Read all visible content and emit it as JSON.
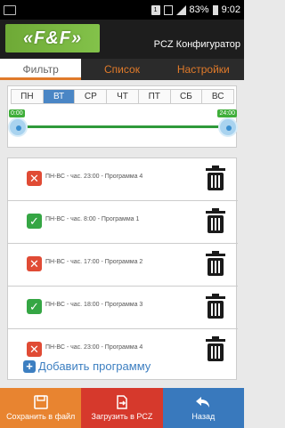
{
  "status_bar": {
    "battery": "83%",
    "time": "9:02",
    "sim_label": "1"
  },
  "app": {
    "logo_text": "«F&F»",
    "title": "PCZ Конфигуратор"
  },
  "tabs": [
    {
      "label": "Фильтр",
      "active": true
    },
    {
      "label": "Список",
      "active": false
    },
    {
      "label": "Настройки",
      "active": false
    }
  ],
  "days": [
    {
      "label": "ПН",
      "active": false
    },
    {
      "label": "ВТ",
      "active": true
    },
    {
      "label": "СР",
      "active": false
    },
    {
      "label": "ЧТ",
      "active": false
    },
    {
      "label": "ПТ",
      "active": false
    },
    {
      "label": "СБ",
      "active": false
    },
    {
      "label": "ВС",
      "active": false
    }
  ],
  "time_range": {
    "start": "0:00",
    "end": "24:00"
  },
  "programs": [
    {
      "text": "ПН-ВС - час. 23:00 - Программа 4",
      "enabled": false
    },
    {
      "text": "ПН-ВС - час. 8:00 - Программа 1",
      "enabled": true
    },
    {
      "text": "ПН-ВС - час. 17:00 - Программа 2",
      "enabled": false
    },
    {
      "text": "ПН-ВС - час. 18:00 - Программа 3",
      "enabled": true
    },
    {
      "text": "ПН-ВС - час. 23:00 - Программа 4",
      "enabled": false
    }
  ],
  "add_program_label": "Добавить программу",
  "bottom_bar": {
    "save_label": "Сохранить в файл",
    "load_label": "Загрузить в PCZ",
    "back_label": "Назад"
  },
  "colors": {
    "accent_orange": "#e07a2a",
    "day_active": "#4a86c5",
    "enabled_green": "#35a644",
    "disabled_red": "#e04b35",
    "save_bg": "#e88430",
    "load_bg": "#d6392c",
    "back_bg": "#3979bd"
  }
}
